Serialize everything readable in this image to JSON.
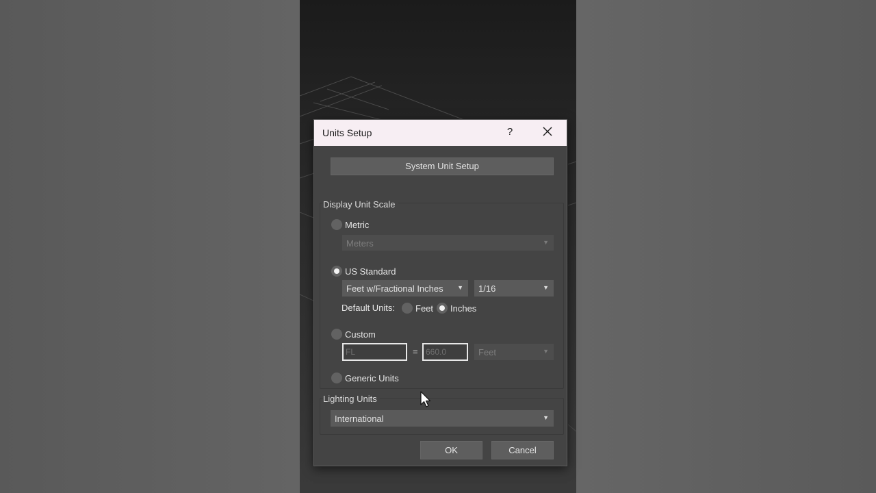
{
  "dialog": {
    "title": "Units Setup",
    "help_label": "?",
    "system_unit_setup_label": "System Unit Setup",
    "display_unit_scale": {
      "group_label": "Display Unit Scale",
      "metric": {
        "label": "Metric",
        "selected": false,
        "unit_value": "Meters"
      },
      "us_standard": {
        "label": "US Standard",
        "selected": true,
        "unit_value": "Feet w/Fractional Inches",
        "fraction_value": "1/16",
        "default_units_label": "Default Units:",
        "default_feet_label": "Feet",
        "default_inches_label": "Inches",
        "default_selected": "Inches"
      },
      "custom": {
        "label": "Custom",
        "selected": false,
        "name_placeholder": "FL",
        "equals": "=",
        "value_placeholder": "660.0",
        "unit_value": "Feet"
      },
      "generic": {
        "label": "Generic Units",
        "selected": false
      }
    },
    "lighting_units": {
      "group_label": "Lighting Units",
      "value": "International"
    },
    "ok_label": "OK",
    "cancel_label": "Cancel"
  },
  "icons": {
    "dropdown_arrow": "▼",
    "close": "close-icon",
    "cursor": "mouse-pointer-icon"
  }
}
